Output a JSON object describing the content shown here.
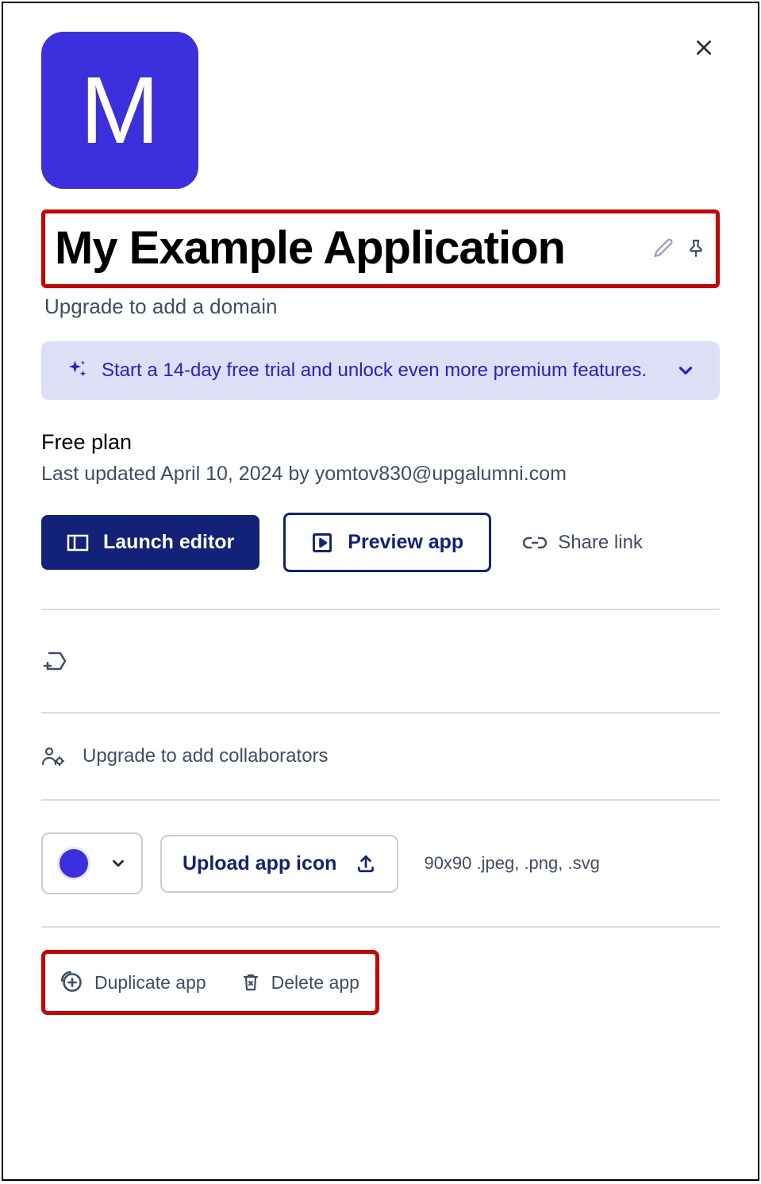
{
  "app": {
    "tile_letter": "M",
    "title": "My Example Application",
    "domain_hint": "Upgrade to add a domain"
  },
  "trial_banner": {
    "text": "Start a 14-day free trial and unlock even more premium features."
  },
  "plan": {
    "label": "Free plan",
    "updated": "Last updated April 10, 2024 by yomtov830@upgalumni.com"
  },
  "actions": {
    "launch": "Launch editor",
    "preview": "Preview app",
    "share": "Share link"
  },
  "collaborators": {
    "hint": "Upgrade to add collaborators"
  },
  "icon_upload": {
    "button": "Upload app icon",
    "hint": "90x90 .jpeg, .png, .svg"
  },
  "footer": {
    "duplicate": "Duplicate app",
    "delete": "Delete app"
  },
  "colors": {
    "primary": "#3b2fde",
    "dark_blue": "#122278"
  }
}
